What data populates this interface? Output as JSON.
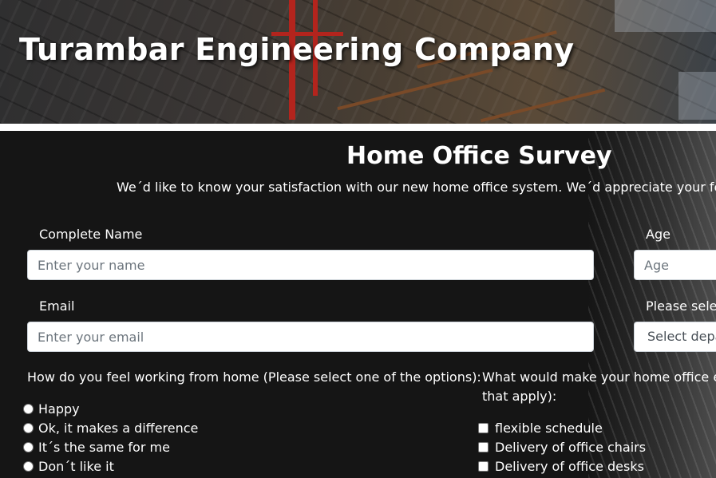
{
  "header": {
    "title": "Turambar Engineering Company"
  },
  "survey": {
    "title": "Home Office Survey",
    "description": "We´d like to know your satisfaction with our new home office system. We´d appreciate your feedback to he"
  },
  "form": {
    "name": {
      "label": "Complete Name",
      "placeholder": "Enter your name"
    },
    "age": {
      "label": "Age",
      "placeholder": "Age"
    },
    "email": {
      "label": "Email",
      "placeholder": "Enter your email"
    },
    "department": {
      "label": "Please select",
      "selected": "Select depar"
    }
  },
  "question_feel": {
    "text": "How do you feel working from home (Please select one of the options):",
    "options": [
      "Happy",
      "Ok, it makes a difference",
      "It´s the same for me",
      "Don´t like it"
    ]
  },
  "question_improve": {
    "text": "What would make your home office expe that apply):",
    "line1": "What would make your home office expe",
    "line2": "that apply):",
    "options": [
      "flexible schedule",
      "Delivery of office chairs",
      "Delivery of office desks"
    ]
  },
  "colors": {
    "background": "#151515",
    "text": "#ffffff",
    "input_bg": "#ffffff",
    "placeholder": "#6c757d"
  }
}
